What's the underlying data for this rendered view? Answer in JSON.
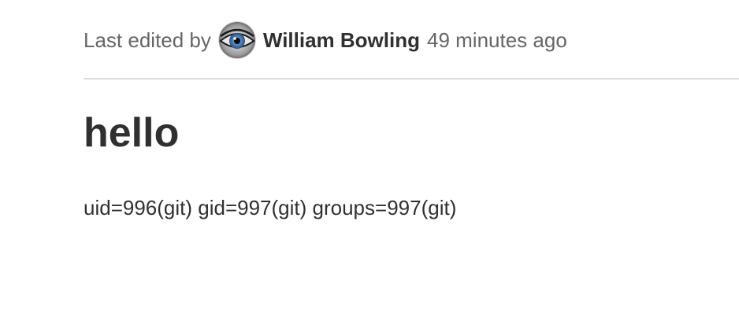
{
  "meta": {
    "prefix": "Last edited by",
    "avatar_icon": "user-avatar-eye",
    "author": "William Bowling",
    "time_ago": "49 minutes ago"
  },
  "content": {
    "title": "hello",
    "body": "uid=996(git) gid=997(git) groups=997(git)"
  },
  "colors": {
    "text_muted": "#666666",
    "text_strong": "#303030",
    "divider": "#dcdcdc"
  }
}
